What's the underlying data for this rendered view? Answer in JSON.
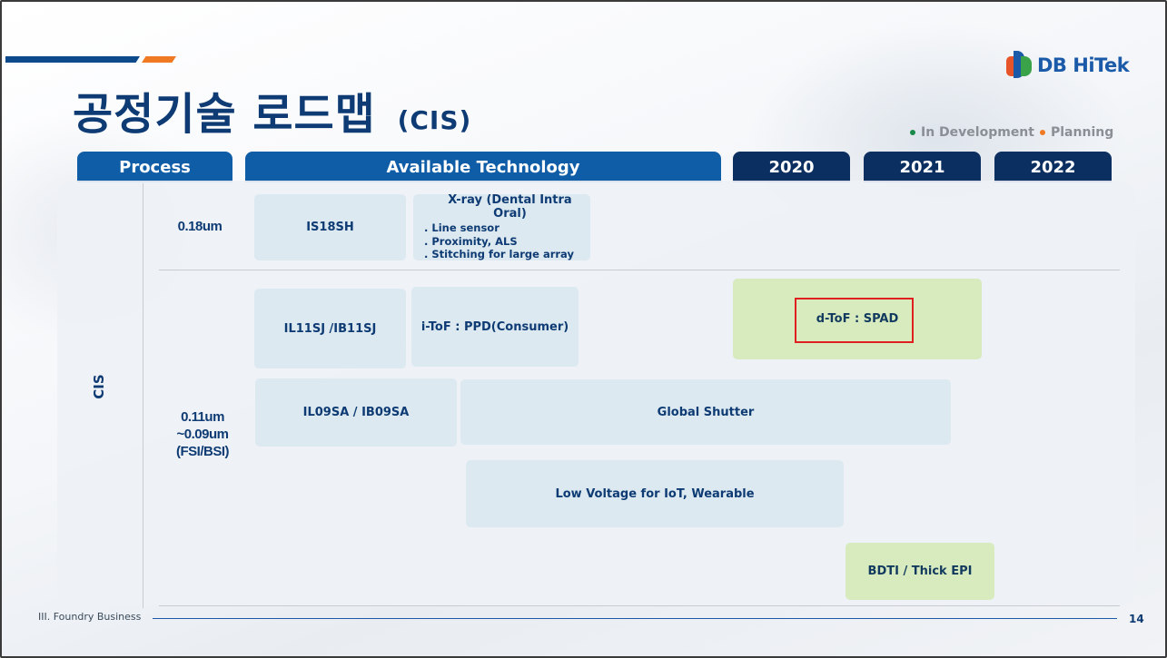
{
  "slide": {
    "title": "공정기술 로드맵",
    "subtitle": "(CIS)",
    "logo_text": "DB HiTek",
    "legend": {
      "in_development": "In Development",
      "planning": "Planning"
    },
    "colors": {
      "in_development": "#1a8a4a",
      "planning": "#f07a24",
      "primary": "#0f5ca7",
      "dark": "#0c2f62",
      "green_box": "#d7ebbf",
      "blue_box": "#dce9f0",
      "highlight": "#e02020"
    }
  },
  "headers": {
    "process": "Process",
    "available": "Available Technology",
    "y2020": "2020",
    "y2021": "2021",
    "y2022": "2022"
  },
  "category": "CIS",
  "nodes": {
    "n018": "0.18um",
    "n011_line1": "0.11um",
    "n011_line2": "~0.09um",
    "n011_line3": "(FSI/BSI)"
  },
  "techs": {
    "is18sh": "IS18SH",
    "xray_title": "X-ray (Dental Intra Oral)",
    "xray_items": [
      ". Line sensor",
      ". Proximity, ALS",
      ". Stitching for large array"
    ],
    "il11sj": "IL11SJ /IB11SJ",
    "itof": "i-ToF : PPD(Consumer)",
    "dtof": "d-ToF : SPAD",
    "il09sa": "IL09SA / IB09SA",
    "global_shutter": "Global Shutter",
    "low_voltage": "Low Voltage for IoT, Wearable",
    "bdti": "BDTI / Thick EPI"
  },
  "footer": {
    "section": "III. Foundry Business",
    "page": "14"
  }
}
